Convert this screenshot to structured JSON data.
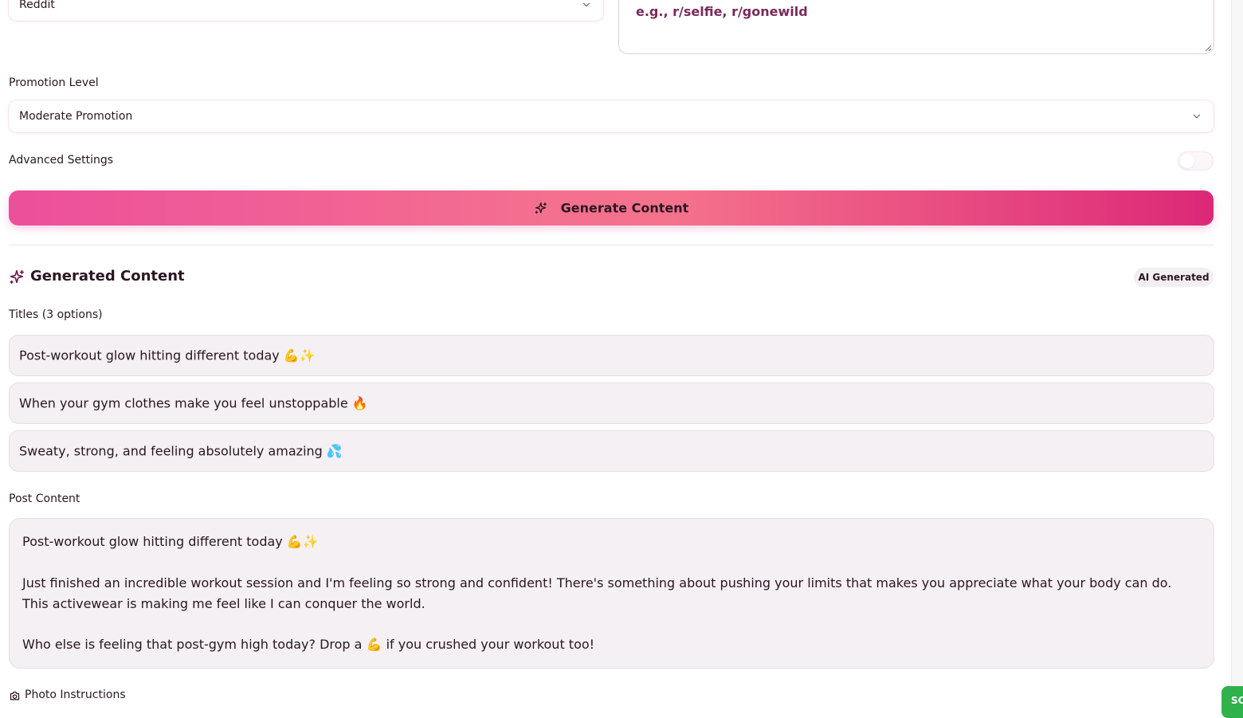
{
  "platform": {
    "selected": "Reddit"
  },
  "subreddits": {
    "placeholder": "e.g., r/selfie, r/gonewild"
  },
  "promotion": {
    "label": "Promotion Level",
    "selected": "Moderate Promotion"
  },
  "advanced": {
    "label": "Advanced Settings",
    "enabled": false
  },
  "generate_button": {
    "label": "Generate Content"
  },
  "generated": {
    "title": "Generated Content",
    "badge": "AI Generated",
    "titles_label": "Titles (3 options)",
    "titles": [
      "Post-workout glow hitting different today 💪✨",
      "When your gym clothes make you feel unstoppable 🔥",
      "Sweaty, strong, and feeling absolutely amazing 💦"
    ],
    "post_label": "Post Content",
    "post_paragraphs": [
      "Post-workout glow hitting different today 💪✨",
      "Just finished an incredible workout session and I'm feeling so strong and confident! There's something about pushing your limits that makes you appreciate what your body can do. This activewear is making me feel like I can conquer the world.",
      "Who else is feeling that post-gym high today? Drop a 💪 if you crushed your workout too!"
    ],
    "photo_label": "Photo Instructions"
  },
  "floating_button": {
    "label": "SC"
  },
  "colors": {
    "accent_start": "#ec4f9b",
    "accent_end": "#dc2877",
    "text": "#2a1622",
    "box_bg": "#f4f0f3",
    "success": "#2fb24b"
  }
}
